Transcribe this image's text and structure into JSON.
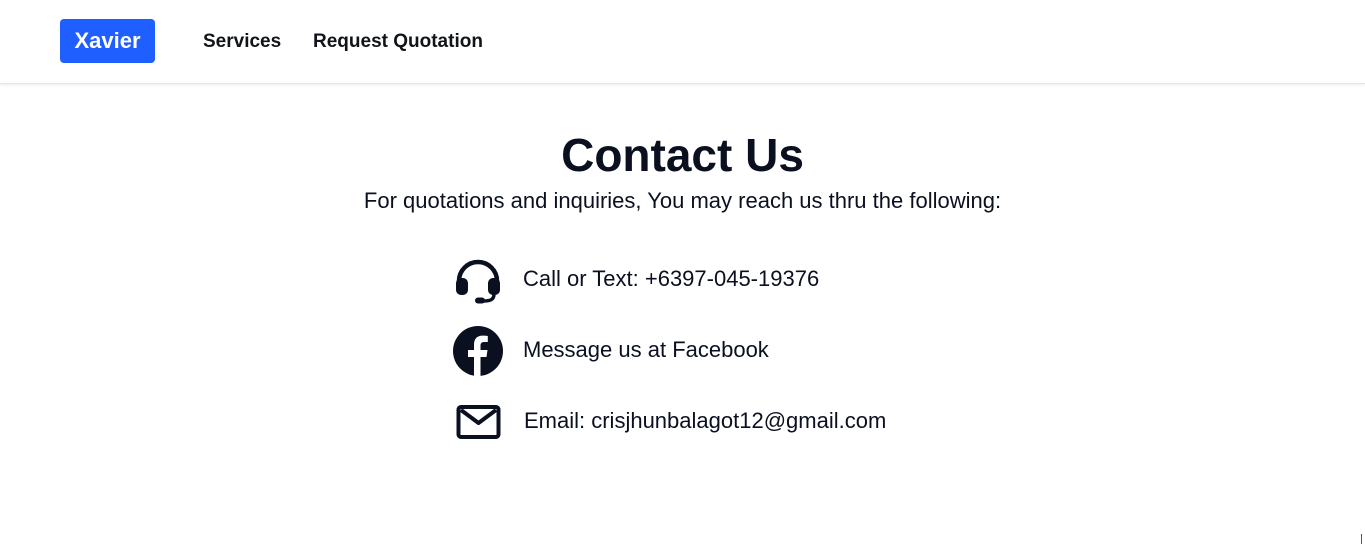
{
  "navbar": {
    "brand": "Xavier",
    "links": [
      {
        "label": "Services"
      },
      {
        "label": "Request Quotation"
      }
    ]
  },
  "main": {
    "title": "Contact Us",
    "subtitle": "For quotations and inquiries, You may reach us thru the following:",
    "contacts": [
      {
        "icon": "headset-icon",
        "text": "Call or Text: +6397-045-19376"
      },
      {
        "icon": "facebook-icon",
        "text": "Message us at Facebook"
      },
      {
        "icon": "mail-icon",
        "text": "Email: crisjhunbalagot12@gmail.com"
      }
    ]
  },
  "colors": {
    "brand": "#1f5eff",
    "text": "#0b1020"
  }
}
